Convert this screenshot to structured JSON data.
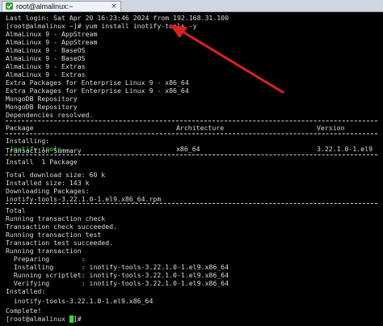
{
  "window": {
    "tab_title": "root@almalinux:~",
    "tab_close_glyph": "×",
    "accent_color": "#2aa52a",
    "arrow_color": "#e01e1e"
  },
  "terminal": {
    "last_login": "Last login: Sat Apr 20 16:23:46 2024 from 192.168.31.100",
    "command_line": "[root@almalinux ~]# yum install inotify-tools -y",
    "repos": [
      "AlmaLinux 9 - AppStream",
      "AlmaLinux 9 - AppStream",
      "AlmaLinux 9 - BaseOS",
      "AlmaLinux 9 - BaseOS",
      "AlmaLinux 9 - Extras",
      "AlmaLinux 9 - Extras",
      "Extra Packages for Enterprise Linux 9 - x86_64",
      "Extra Packages for Enterprise Linux 9 - x86_64",
      "MongoDB Repository",
      "MongoDB Repository"
    ],
    "deps_resolved": "Dependencies resolved.",
    "table": {
      "headers": {
        "package": "Package",
        "architecture": "Architecture",
        "version": "Version"
      },
      "installing_label": "Installing:",
      "row": {
        "package": "inotify-tools",
        "architecture": "x86_64",
        "version": "3.22.1.0-1.el9"
      }
    },
    "transaction_summary": "Transaction Summary",
    "install_count": "Install  1 Package",
    "total_download": "Total download size: 60 k",
    "installed_size": "Installed size: 143 k",
    "downloading": "Downloading Packages:",
    "rpm_file": "inotify-tools-3.22.1.0-1.el9.x86_64.rpm",
    "total": "Total",
    "steps": [
      "Running transaction check",
      "Transaction check succeeded.",
      "Running transaction test",
      "Transaction test succeeded.",
      "Running transaction"
    ],
    "phases": [
      "  Preparing        :",
      "  Installing       : inotify-tools-3.22.1.0-1.el9.x86_64",
      "  Running scriptlet: inotify-tools-3.22.1.0-1.el9.x86_64",
      "  Verifying        : inotify-tools-3.22.1.0-1.el9.x86_64"
    ],
    "installed_label": "Installed:",
    "installed_pkg": "  inotify-tools-3.22.1.0-1.el9.x86_64",
    "complete": "Complete!",
    "final_prompt": "[root@almalinux ~]#"
  }
}
